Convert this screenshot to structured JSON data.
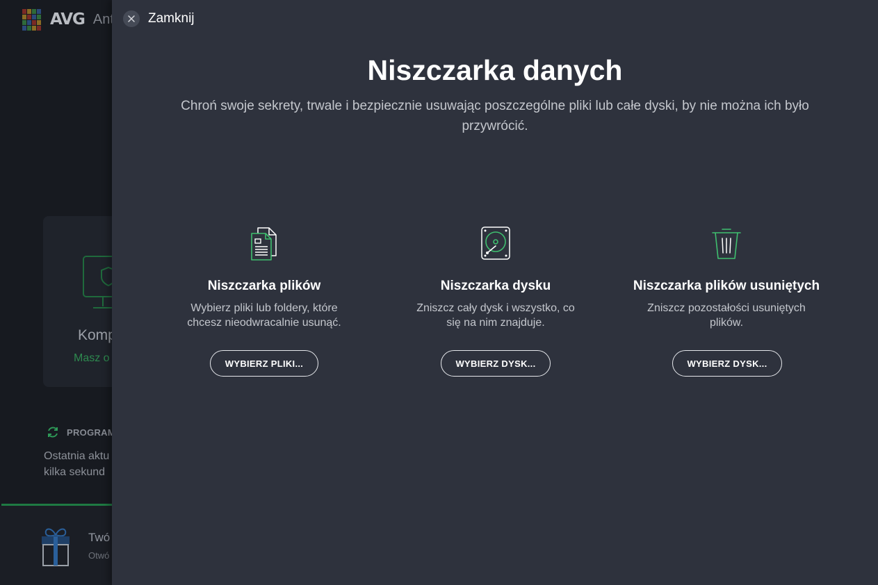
{
  "background": {
    "logo_text": "AVG",
    "app_partial": "Ant",
    "card_title_partial": "Komp",
    "card_status_partial": "Masz o",
    "program_label_partial": "PROGRAM",
    "last_update_line1": "Ostatnia aktu",
    "last_update_line2": "kilka sekund",
    "promo_title_partial": "Twó",
    "promo_sub_partial": "Otwó"
  },
  "overlay": {
    "close_label": "Zamknij",
    "title": "Niszczarka danych",
    "subtitle": "Chroń swoje sekrety, trwale i bezpiecznie usuwając poszczególne pliki lub całe dyski, by nie można ich było przywrócić.",
    "options": [
      {
        "icon": "documents-icon",
        "title": "Niszczarka plików",
        "description": "Wybierz pliki lub foldery, które chcesz nieodwracalnie usunąć.",
        "button": "WYBIERZ PLIKI..."
      },
      {
        "icon": "hard-drive-icon",
        "title": "Niszczarka dysku",
        "description": "Zniszcz cały dysk i wszystko, co się na nim znajduje.",
        "button": "WYBIERZ DYSK..."
      },
      {
        "icon": "trash-bin-icon",
        "title": "Niszczarka plików usuniętych",
        "description": "Zniszcz pozostałości usuniętych plików.",
        "button": "WYBIERZ DYSK..."
      }
    ]
  },
  "colors": {
    "accent_green": "#3fbf6f",
    "panel_bg": "#2e323d",
    "app_bg": "#171a20"
  }
}
